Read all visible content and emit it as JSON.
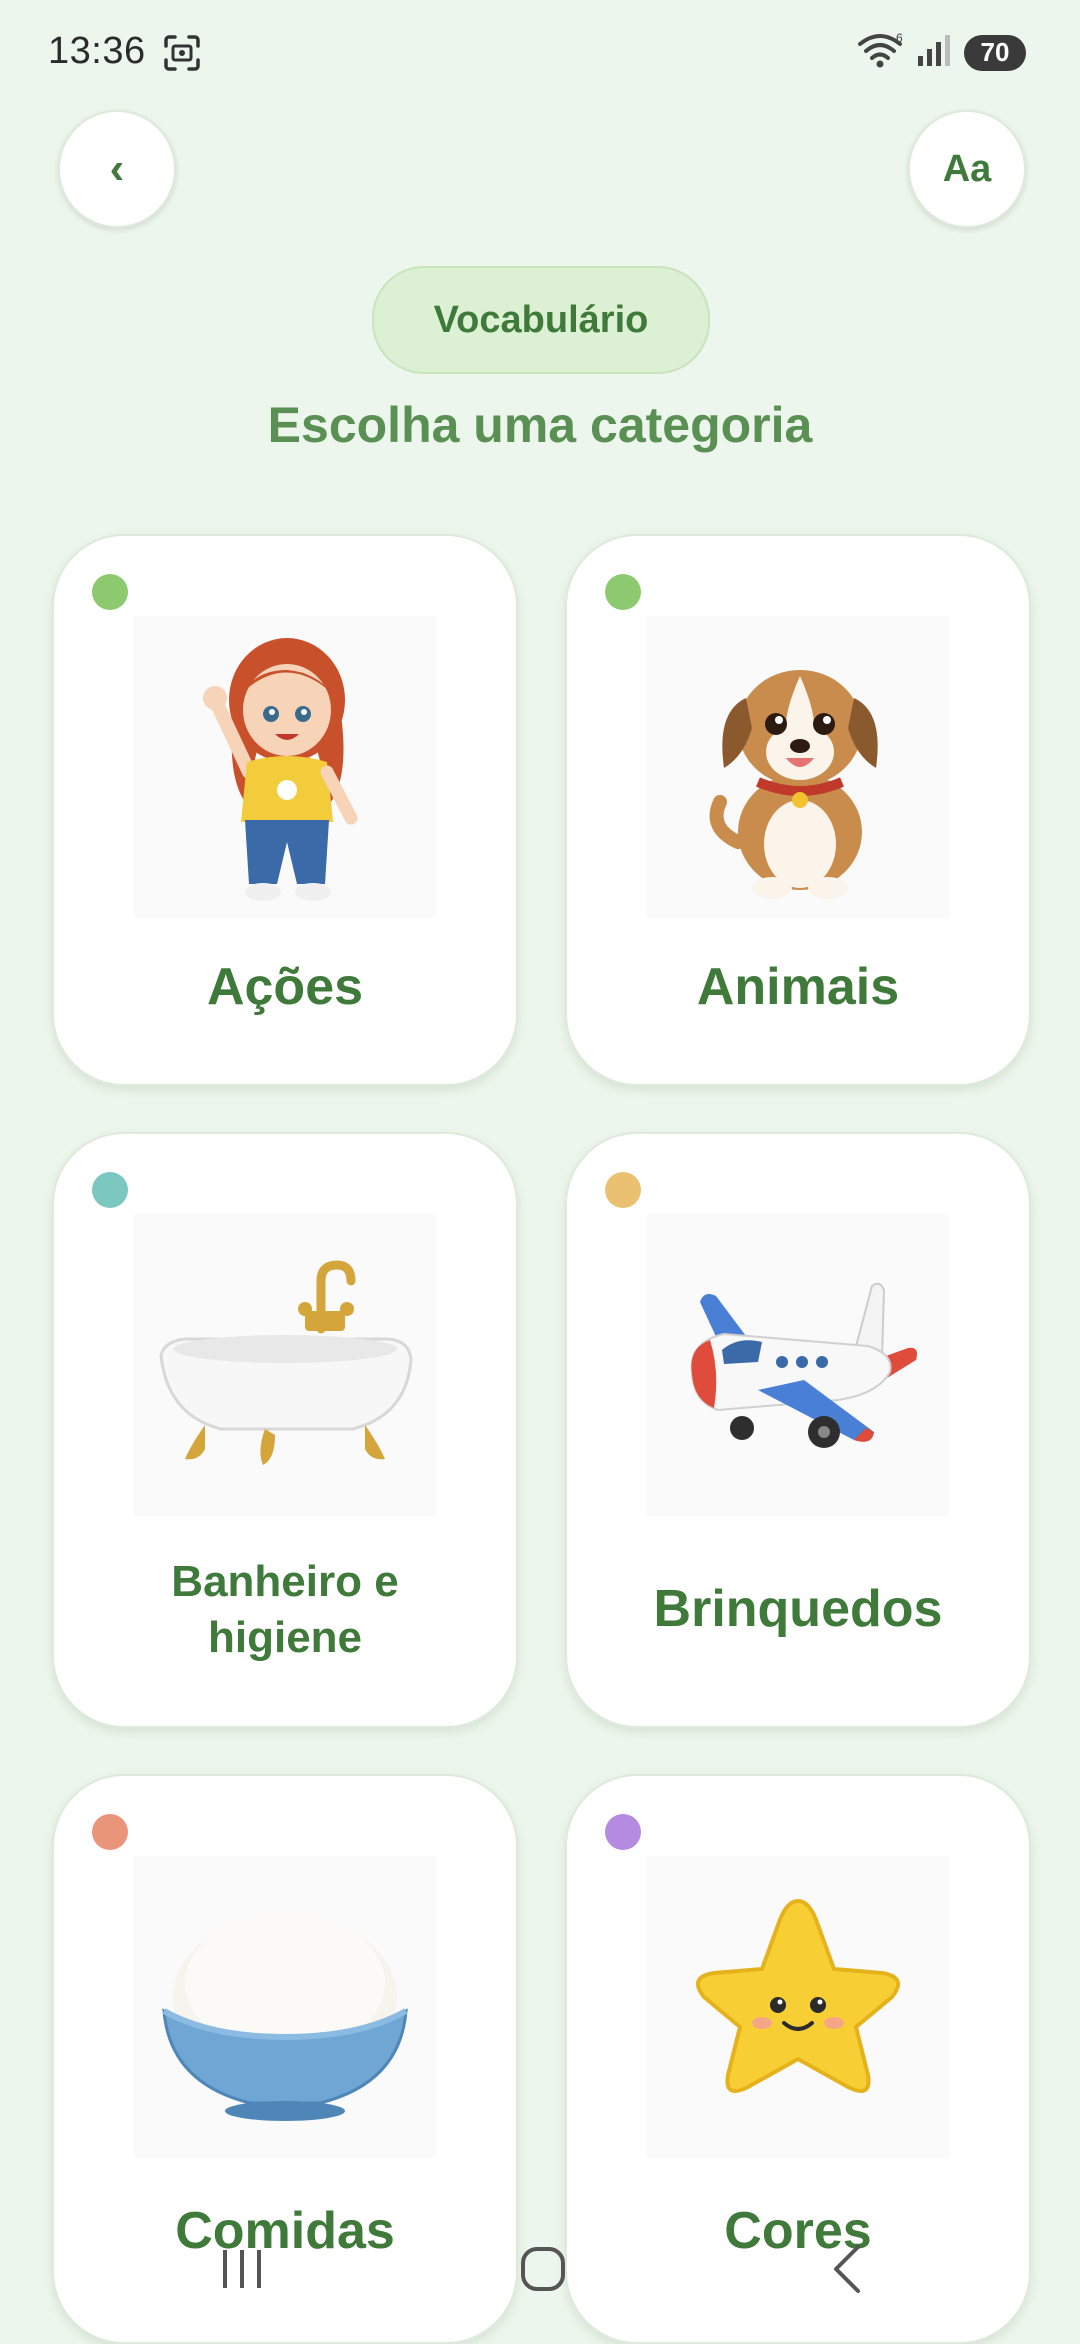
{
  "status_bar": {
    "time": "13:36",
    "battery": "70"
  },
  "header": {
    "back_label": "‹",
    "font_button_label": "Aa",
    "section_pill": "Vocabulário",
    "subtitle": "Escolha uma categoria"
  },
  "categories": [
    {
      "label": "Ações",
      "dot_color": "#8cc96f",
      "image": "girl-waving"
    },
    {
      "label": "Animais",
      "dot_color": "#8cc96f",
      "image": "puppy"
    },
    {
      "label": "Banheiro e",
      "label_line2": "higiene",
      "dot_color": "#7cc8c0",
      "image": "bathtub"
    },
    {
      "label": "Brinquedos",
      "dot_color": "#e9c170",
      "image": "toy-airplane"
    },
    {
      "label": "Comidas",
      "dot_color": "#e9957a",
      "image": "rice-bowl"
    },
    {
      "label": "Cores",
      "dot_color": "#b48be0",
      "image": "star"
    }
  ],
  "nav_bar": {
    "recents_icon": "recents-icon",
    "home_icon": "home-icon",
    "back_icon": "back-icon"
  }
}
